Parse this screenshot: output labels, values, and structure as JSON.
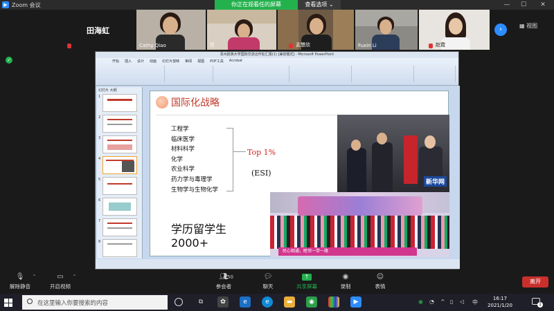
{
  "zoom": {
    "app_title": "Zoom 会议",
    "share_banner": "你正在观看任的屏幕",
    "view_options": "查看选项 ⌄",
    "view_button": "视图"
  },
  "gallery": {
    "active_speaker": "田海虹",
    "tiles": [
      {
        "name": "Cathy Qiao"
      },
      {
        "name": "任"
      },
      {
        "name": "孟慧欣"
      },
      {
        "name": "Fuxin Li"
      },
      {
        "name": "赵霓"
      }
    ]
  },
  "ppt": {
    "window_title": "贵州民族大学国际交流合作处汇报(1) [兼容模式] - Microsoft PowerPoint",
    "tabs": [
      "开始",
      "插入",
      "设计",
      "动画",
      "幻灯片放映",
      "审阅",
      "视图",
      "PDF工具",
      "Acrobat"
    ],
    "panel_tabs": "幻灯片  大纲",
    "thumb_numbers": [
      "1",
      "2",
      "3",
      "4",
      "5",
      "6",
      "7",
      "8"
    ]
  },
  "slide": {
    "heading": "国际化战略",
    "disciplines": [
      "工程学",
      "临床医学",
      "材料科学",
      "化学",
      "农业科学",
      "药力学与毒理学",
      "生物学与生物化学"
    ],
    "top_label": "Top 1%",
    "esi_label": "(ESI)",
    "students_line1": "学历留学生",
    "students_line2": "2000+",
    "photo1_watermark": "新华网",
    "photo2_banner": "民心相通，睦邻一带一路"
  },
  "controls": {
    "unmute": "解除静音",
    "start_video": "开启视频",
    "participants": "参会者",
    "participants_count": "50",
    "chat": "聊天",
    "share_screen": "共享屏幕",
    "record": "录制",
    "reactions": "表情",
    "leave": "离开"
  },
  "taskbar": {
    "search_placeholder": "在这里输入你要搜索的内容",
    "ime": "中",
    "time": "16:17",
    "date": "2021/1/20",
    "notification_count": "1"
  }
}
